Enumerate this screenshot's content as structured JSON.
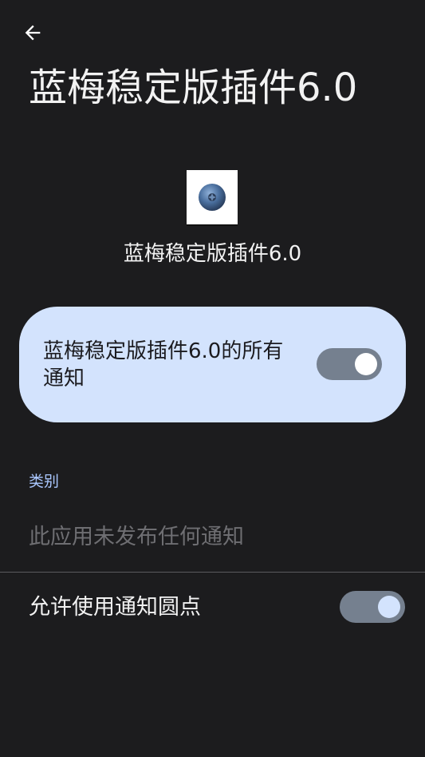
{
  "header": {
    "back_label": "back",
    "title": "蓝梅稳定版插件6.0"
  },
  "app": {
    "icon": "blueberry-icon",
    "name": "蓝梅稳定版插件6.0"
  },
  "master_toggle": {
    "label": "蓝梅稳定版插件6.0的所有通知",
    "enabled": true
  },
  "categories": {
    "header": "类别",
    "empty_text": "此应用未发布任何通知"
  },
  "notification_dots": {
    "label": "允许使用通知圆点",
    "enabled": true
  },
  "colors": {
    "background": "#1c1c1e",
    "card": "#d3e3fd",
    "accent": "#aac7ff",
    "switch_track": "#75808f"
  }
}
